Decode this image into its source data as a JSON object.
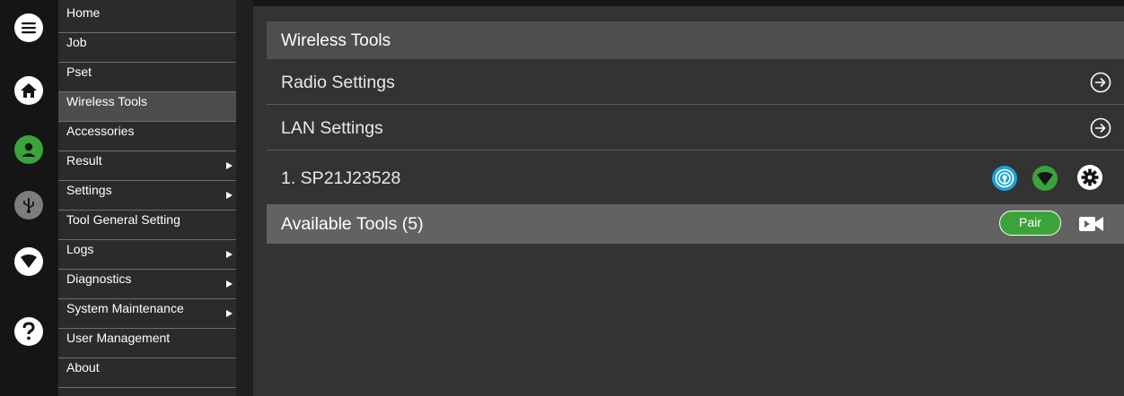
{
  "rail": {
    "icons": [
      "menu-icon",
      "home-icon",
      "user-icon",
      "usb-icon",
      "network-icon",
      "help-icon"
    ],
    "colors": {
      "user": "#3aa43a",
      "usb": "#7d7d7d",
      "default": "#ffffff"
    }
  },
  "menu": {
    "items": [
      {
        "label": "Home",
        "has_submenu": false,
        "active": false
      },
      {
        "label": "Job",
        "has_submenu": false,
        "active": false
      },
      {
        "label": "Pset",
        "has_submenu": false,
        "active": false
      },
      {
        "label": "Wireless Tools",
        "has_submenu": false,
        "active": true
      },
      {
        "label": "Accessories",
        "has_submenu": false,
        "active": false
      },
      {
        "label": "Result",
        "has_submenu": true,
        "active": false
      },
      {
        "label": "Settings",
        "has_submenu": true,
        "active": false
      },
      {
        "label": "Tool General Setting",
        "has_submenu": false,
        "active": false
      },
      {
        "label": "Logs",
        "has_submenu": true,
        "active": false
      },
      {
        "label": "Diagnostics",
        "has_submenu": true,
        "active": false
      },
      {
        "label": "System Maintenance",
        "has_submenu": true,
        "active": false
      },
      {
        "label": "User Management",
        "has_submenu": false,
        "active": false
      },
      {
        "label": "About",
        "has_submenu": false,
        "active": false
      }
    ]
  },
  "main": {
    "title": "Wireless Tools",
    "radio_settings": "Radio Settings",
    "lan_settings": "LAN Settings",
    "tool": {
      "name": "1. SP21J23528",
      "icons": [
        "wireless-signal-icon",
        "network-icon",
        "gear-icon"
      ],
      "colors": {
        "wireless": "#1fa3d8",
        "network": "#3aa43a"
      }
    },
    "available": {
      "label": "Available Tools (5)",
      "pair_label": "Pair",
      "pair_color": "#3aa43a",
      "video_icon": "video-camera-icon"
    }
  }
}
